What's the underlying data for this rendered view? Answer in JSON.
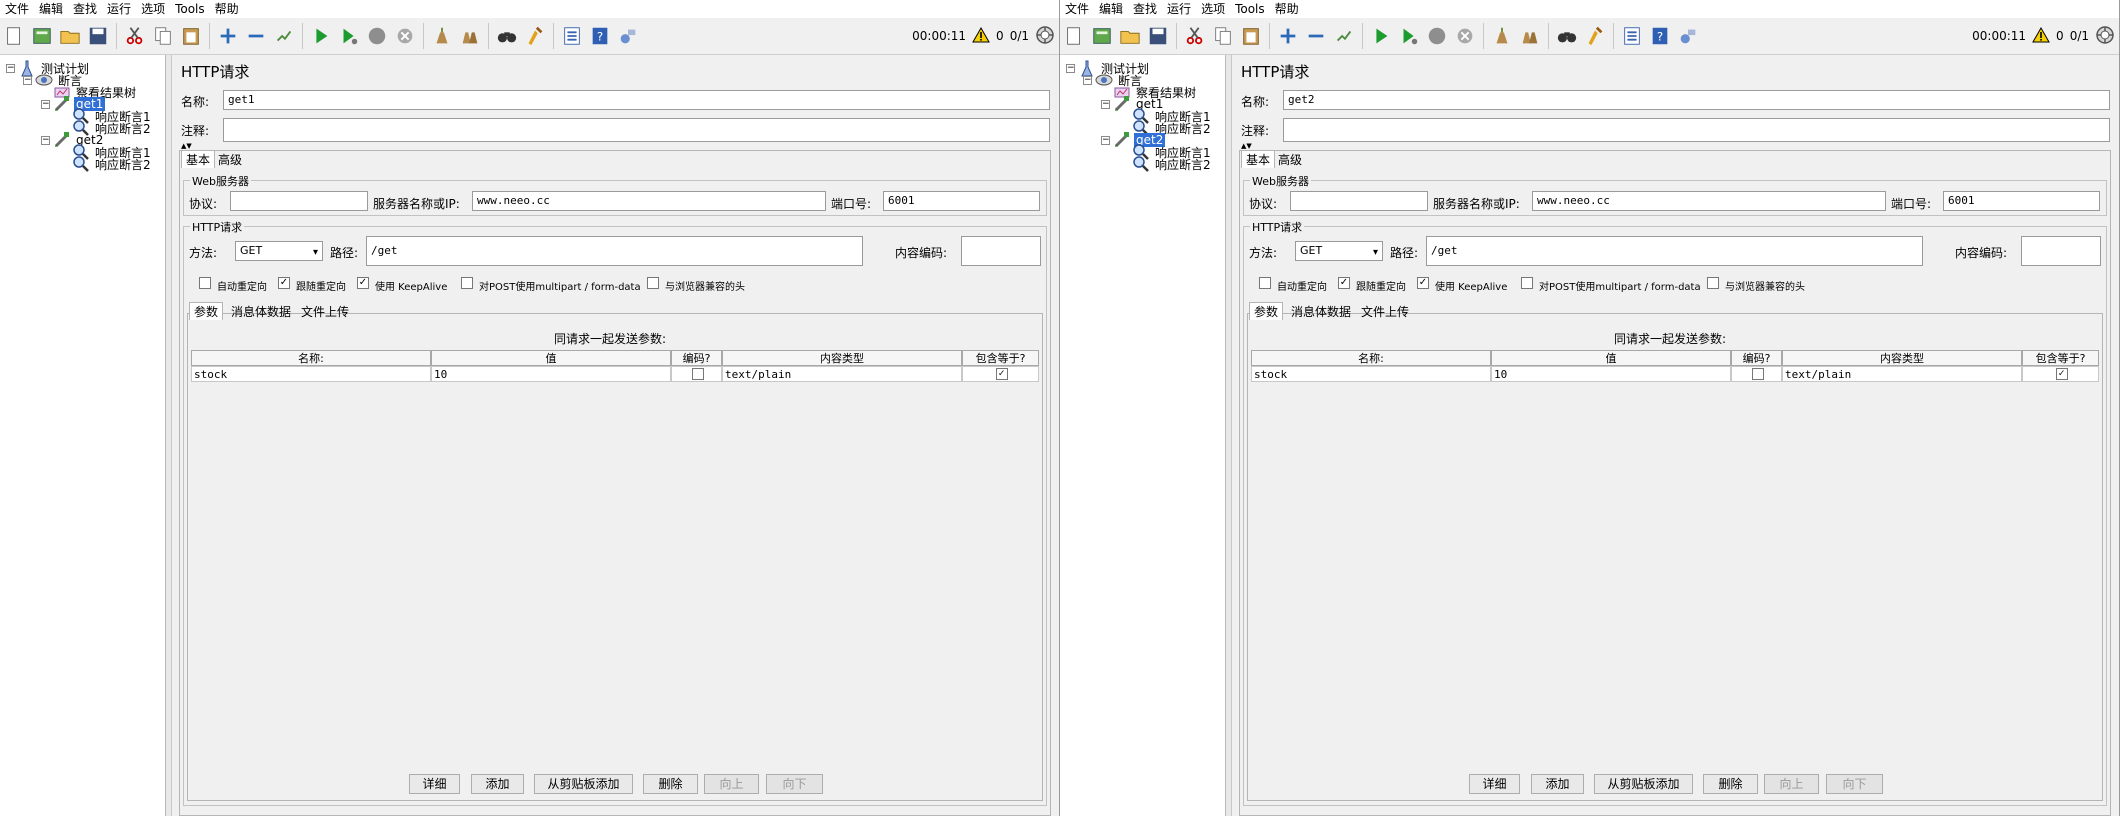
{
  "menu": [
    "文件",
    "编辑",
    "查找",
    "运行",
    "选项",
    "Tools",
    "帮助"
  ],
  "toolbar": {
    "icons": [
      "new-file-icon",
      "templates-icon",
      "open-icon",
      "save-icon",
      "cut-icon",
      "copy-icon",
      "paste-icon",
      "expand-icon",
      "collapse-icon",
      "toggle-icon",
      "start-icon",
      "start-no-pause-icon",
      "stop-icon",
      "shutdown-icon",
      "clear-icon",
      "clear-all-icon",
      "search-icon",
      "reset-search-icon",
      "function-helper-icon",
      "help-icon",
      "remote-icon"
    ],
    "timer": "00:00:11",
    "warning_count": "0",
    "threads": "0/1"
  },
  "labels": {
    "name": "名称:",
    "comment": "注释:",
    "tab_basic": "基本",
    "tab_advanced": "高级",
    "web_server": "Web服务器",
    "protocol": "协议:",
    "server": "服务器名称或IP:",
    "port": "端口号:",
    "http_request": "HTTP请求",
    "method": "方法:",
    "path": "路径:",
    "encoding": "内容编码:",
    "auto_redirect": "自动重定向",
    "follow_redirect": "跟随重定向",
    "keepalive": "使用 KeepAlive",
    "multipart": "对POST使用multipart / form-data",
    "browser_headers": "与浏览器兼容的头",
    "tab_params": "参数",
    "tab_body": "消息体数据",
    "tab_files": "文件上传",
    "send_params": "同请求一起发送参数:",
    "col_name": "名称:",
    "col_value": "值",
    "col_encode": "编码?",
    "col_type": "内容类型",
    "col_include": "包含等于?",
    "btn_detail": "详细",
    "btn_add": "添加",
    "btn_clipboard": "从剪贴板添加",
    "btn_delete": "删除",
    "btn_up": "向上",
    "btn_down": "向下"
  },
  "windows": [
    {
      "tree": [
        {
          "label": "测试计划",
          "icon": "test-plan-icon"
        },
        {
          "label": "断言",
          "icon": "thread-group-icon"
        },
        {
          "label": "察看结果树",
          "icon": "listener-icon"
        },
        {
          "label": "get1",
          "icon": "sampler-icon"
        },
        {
          "label": "响应断言1",
          "icon": "assertion-icon"
        },
        {
          "label": "响应断言2",
          "icon": "assertion-icon"
        },
        {
          "label": "get2",
          "icon": "sampler-icon"
        },
        {
          "label": "响应断言1",
          "icon": "assertion-icon"
        },
        {
          "label": "响应断言2",
          "icon": "assertion-icon"
        }
      ],
      "selected_index": 3,
      "editor": {
        "title": "HTTP请求",
        "name_value": "get1",
        "comment_value": "",
        "protocol_value": "",
        "server_value": "www.neeo.cc",
        "port_value": "6001",
        "method_value": "GET",
        "path_value": "/get",
        "encoding_value": "",
        "checks": {
          "auto_redirect": false,
          "follow_redirect": true,
          "keepalive": true,
          "multipart": false,
          "browser_headers": false
        },
        "params": [
          {
            "name": "stock",
            "value": "10",
            "encode": false,
            "type": "text/plain",
            "include": true
          }
        ]
      }
    },
    {
      "tree": [
        {
          "label": "测试计划",
          "icon": "test-plan-icon"
        },
        {
          "label": "断言",
          "icon": "thread-group-icon"
        },
        {
          "label": "察看结果树",
          "icon": "listener-icon"
        },
        {
          "label": "get1",
          "icon": "sampler-icon"
        },
        {
          "label": "响应断言1",
          "icon": "assertion-icon"
        },
        {
          "label": "响应断言2",
          "icon": "assertion-icon"
        },
        {
          "label": "get2",
          "icon": "sampler-icon"
        },
        {
          "label": "响应断言1",
          "icon": "assertion-icon"
        },
        {
          "label": "响应断言2",
          "icon": "assertion-icon"
        }
      ],
      "selected_index": 6,
      "editor": {
        "title": "HTTP请求",
        "name_value": "get2",
        "comment_value": "",
        "protocol_value": "",
        "server_value": "www.neeo.cc",
        "port_value": "6001",
        "method_value": "GET",
        "path_value": "/get",
        "encoding_value": "",
        "checks": {
          "auto_redirect": false,
          "follow_redirect": true,
          "keepalive": true,
          "multipart": false,
          "browser_headers": false
        },
        "params": [
          {
            "name": "stock",
            "value": "10",
            "encode": false,
            "type": "text/plain",
            "include": true
          }
        ]
      }
    }
  ]
}
